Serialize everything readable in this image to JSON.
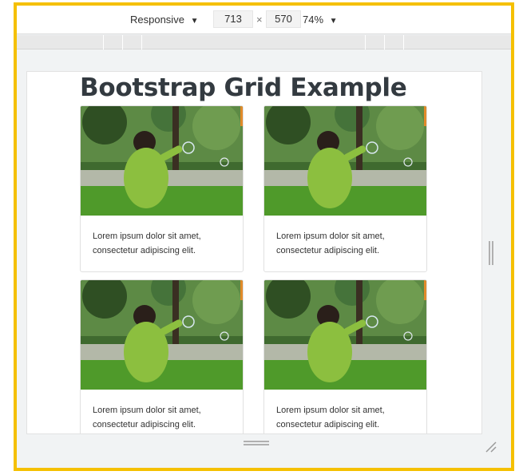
{
  "toolbar": {
    "device": "Responsive",
    "width": "713",
    "times": "×",
    "height": "570",
    "zoom": "74%",
    "caret": "▼"
  },
  "page": {
    "title": "Bootstrap Grid Example",
    "cards": [
      {
        "text": "Lorem ipsum dolor sit amet, consectetur adipiscing elit."
      },
      {
        "text": "Lorem ipsum dolor sit amet, consectetur adipiscing elit."
      },
      {
        "text": "Lorem ipsum dolor sit amet, consectetur adipiscing elit."
      },
      {
        "text": "Lorem ipsum dolor sit amet, consectetur adipiscing elit."
      }
    ]
  },
  "colors": {
    "frame_border": "#f5c000",
    "grass": "#4f9a2a",
    "jacket": "#8cbf3f"
  },
  "icons": {
    "dropdown": "caret-down-icon",
    "resize_side": "resize-handle-icon",
    "resize_bottom": "resize-handle-icon",
    "resize_corner": "resize-corner-icon"
  }
}
